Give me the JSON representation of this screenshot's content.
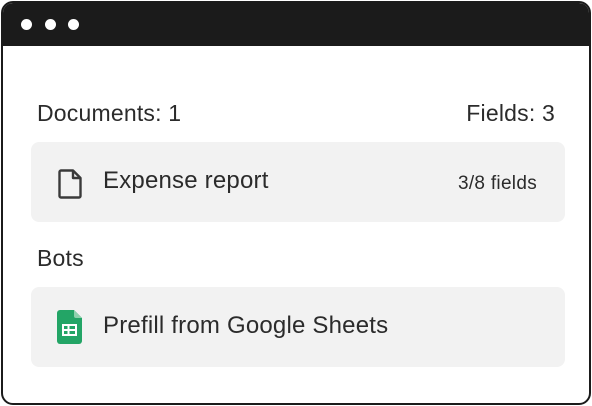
{
  "summary": {
    "documents_label": "Documents: 1",
    "fields_label": "Fields: 3"
  },
  "documents": [
    {
      "icon": "document-icon",
      "title": "Expense report",
      "fields": "3/8 fields"
    }
  ],
  "bots_section": {
    "title": "Bots",
    "items": [
      {
        "icon": "google-sheets-icon",
        "title": "Prefill from Google Sheets"
      }
    ]
  },
  "colors": {
    "titlebar": "#1b1b1b",
    "card_background": "#f2f2f2",
    "sheets_green": "#23a566",
    "text": "#2b2b2b"
  }
}
